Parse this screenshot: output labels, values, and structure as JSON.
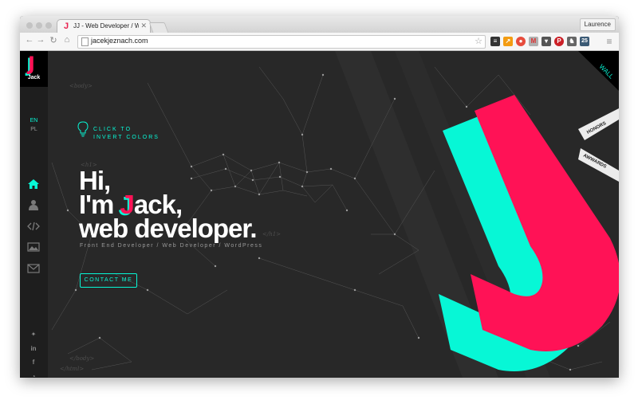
{
  "browser": {
    "tab_title": "JJ - Web Developer / Wordp",
    "tab_favicon": "J",
    "profile_name": "Laurence",
    "url": "jacekjeznach.com",
    "extension_badge": "25"
  },
  "sidebar": {
    "logo_letter": "J",
    "logo_name": "Jack",
    "languages": [
      "EN",
      "PL"
    ],
    "nav_icons": [
      "home-icon",
      "user-icon",
      "code-icon",
      "image-icon",
      "mail-icon"
    ],
    "social_icons": [
      "twitter-icon",
      "linkedin-icon",
      "facebook-icon",
      "rss-icon"
    ]
  },
  "hero": {
    "invert_line1": "CLICK TO",
    "invert_line2": "INVERT COLORS",
    "greeting": "Hi,",
    "name_prefix": "I'm ",
    "name_first_letter": "J",
    "name_rest": "ack,",
    "role": "web developer.",
    "subtitle": "Front End Developer / Web Developer / WordPress",
    "contact_label": "CONTACT ME"
  },
  "decor": {
    "tag_body_open": "<body>",
    "tag_h1_open": "<h1>",
    "tag_h1_close": "</h1>",
    "tag_body_close": "</body>",
    "tag_html_close": "</html>",
    "wall_label": "WALL",
    "honors_label": "HONORS",
    "awards_label": "AWWARDS"
  },
  "colors": {
    "accent_pink": "#ff1256",
    "accent_cyan": "#07f7d6",
    "background": "#282828"
  }
}
